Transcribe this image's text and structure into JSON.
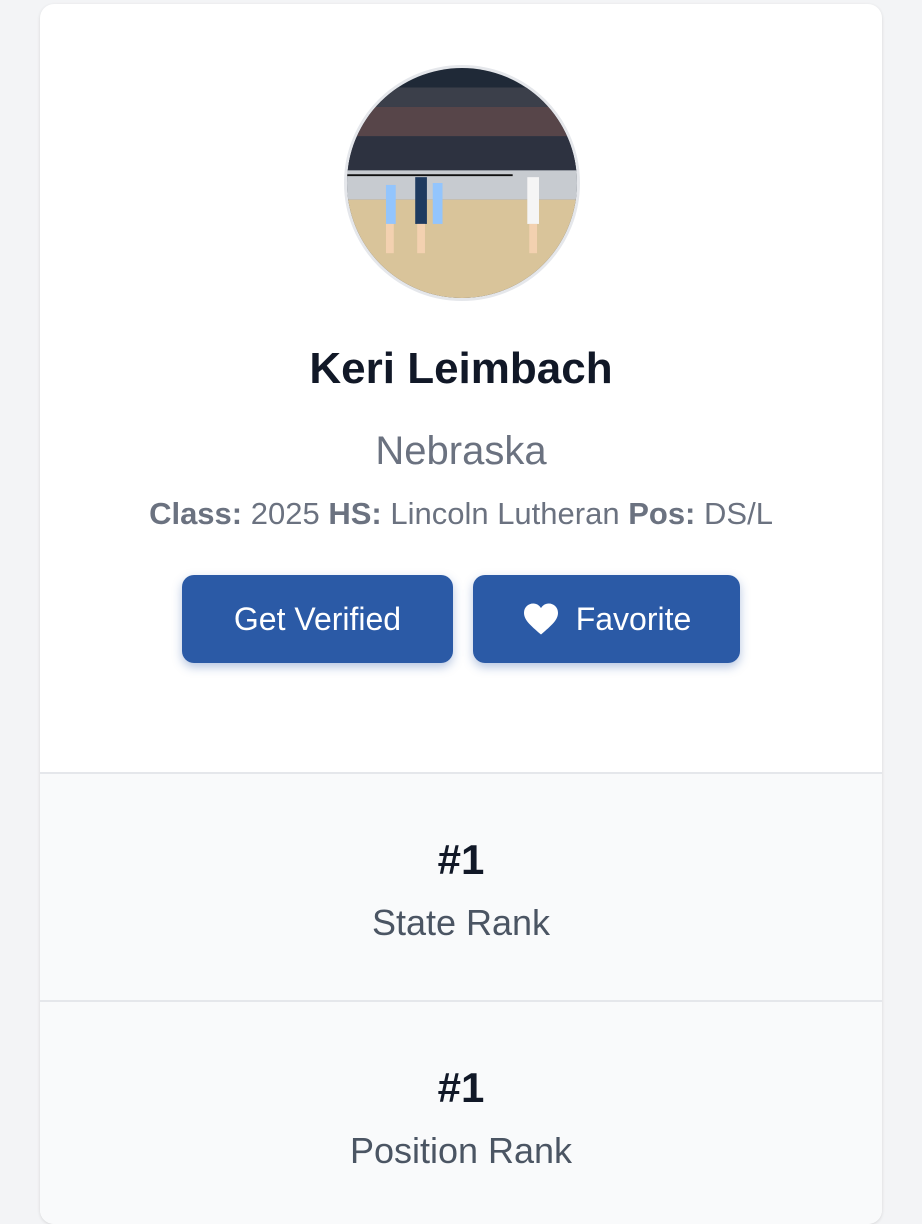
{
  "profile": {
    "name": "Keri Leimbach",
    "state": "Nebraska",
    "class_label": "Class:",
    "class_value": "2025",
    "hs_label": "HS:",
    "hs_value": "Lincoln Lutheran",
    "pos_label": "Pos:",
    "pos_value": "DS/L",
    "avatar_icon": "volleyball-court-photo"
  },
  "actions": {
    "verify_label": "Get Verified",
    "favorite_label": "Favorite",
    "favorite_icon": "heart-icon",
    "button_color": "#2b5aa6"
  },
  "ranks": [
    {
      "value": "#1",
      "label": "State Rank"
    },
    {
      "value": "#1",
      "label": "Position Rank"
    }
  ]
}
